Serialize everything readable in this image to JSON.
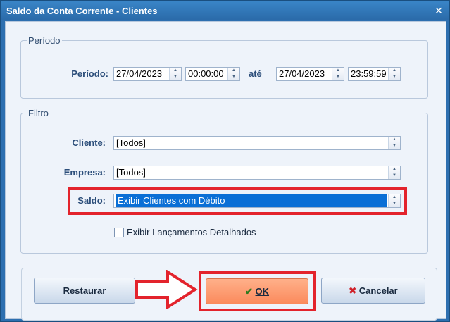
{
  "window": {
    "title": "Saldo da Conta Corrente - Clientes",
    "close_symbol": "✕"
  },
  "periodo": {
    "group_title": "Período",
    "label": "Período:",
    "date_from": "27/04/2023",
    "time_from": "00:00:00",
    "separator": "até",
    "date_to": "27/04/2023",
    "time_to": "23:59:59"
  },
  "filtro": {
    "group_title": "Filtro",
    "cliente_label": "Cliente:",
    "cliente_value": "[Todos]",
    "empresa_label": "Empresa:",
    "empresa_value": "[Todos]",
    "saldo_label": "Saldo:",
    "saldo_value": "Exibir Clientes com Débito",
    "detalhados_label": "Exibir Lançamentos Detalhados",
    "detalhados_checked": false
  },
  "buttons": {
    "restaurar": "Restaurar",
    "ok": "OK",
    "cancelar": "Cancelar"
  },
  "colors": {
    "highlight": "#e3232c",
    "selection": "#0a6fd6",
    "ok_button": "#fb8a5c"
  }
}
